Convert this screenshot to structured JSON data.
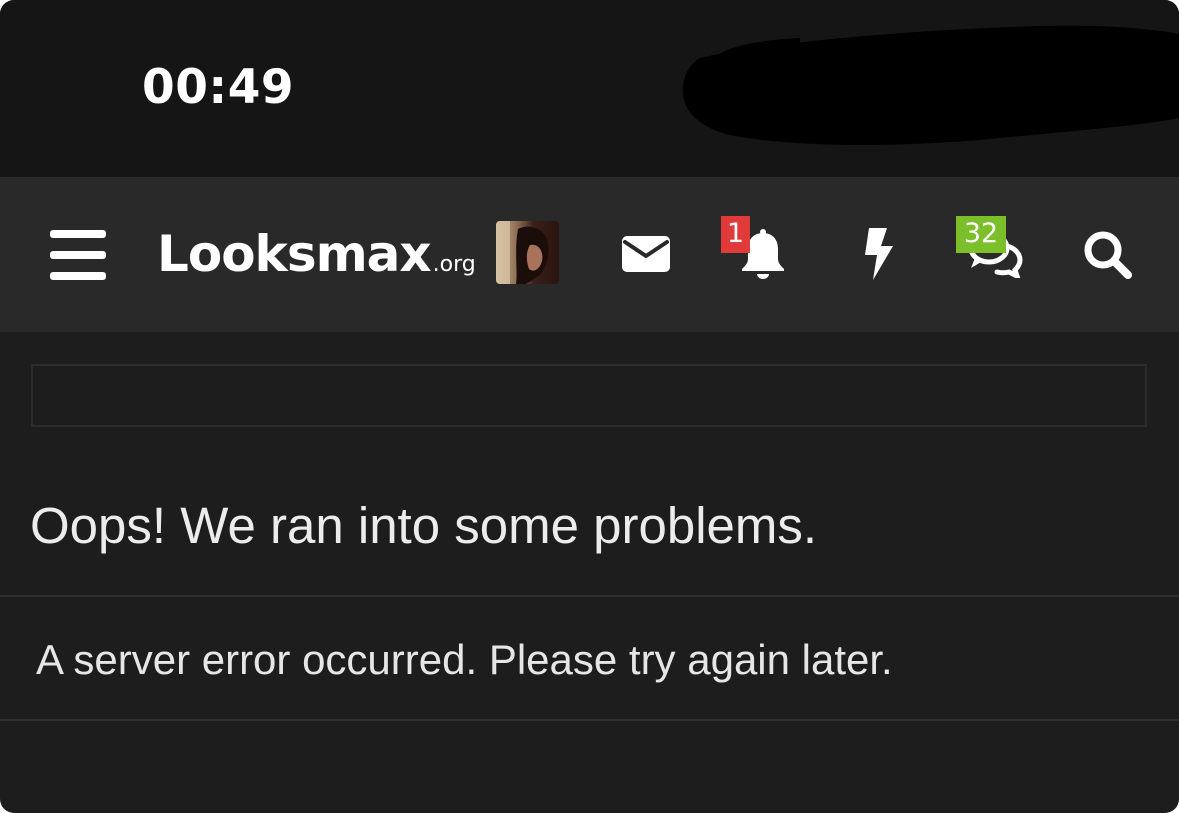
{
  "status_bar": {
    "time": "00:49"
  },
  "navbar": {
    "menu_icon": "hamburger-menu-icon",
    "logo": {
      "main": "Looksmax",
      "tld": ".org"
    },
    "avatar_icon": "user-avatar",
    "inbox_icon": "envelope-icon",
    "alerts": {
      "icon": "bell-icon",
      "count": "1",
      "badge_color": "#e03a3a"
    },
    "whats_new_icon": "bolt-icon",
    "conversations": {
      "icon": "chat-bubbles-icon",
      "count": "32",
      "badge_color": "#7bbf2a"
    },
    "search_icon": "magnifier-icon"
  },
  "content": {
    "error_title": "Oops! We ran into some problems.",
    "error_message": "A server error occurred. Please try again later."
  },
  "colors": {
    "page_background": "#1d1d1d",
    "navbar_background": "#292929",
    "status_bar_background": "#151515"
  }
}
